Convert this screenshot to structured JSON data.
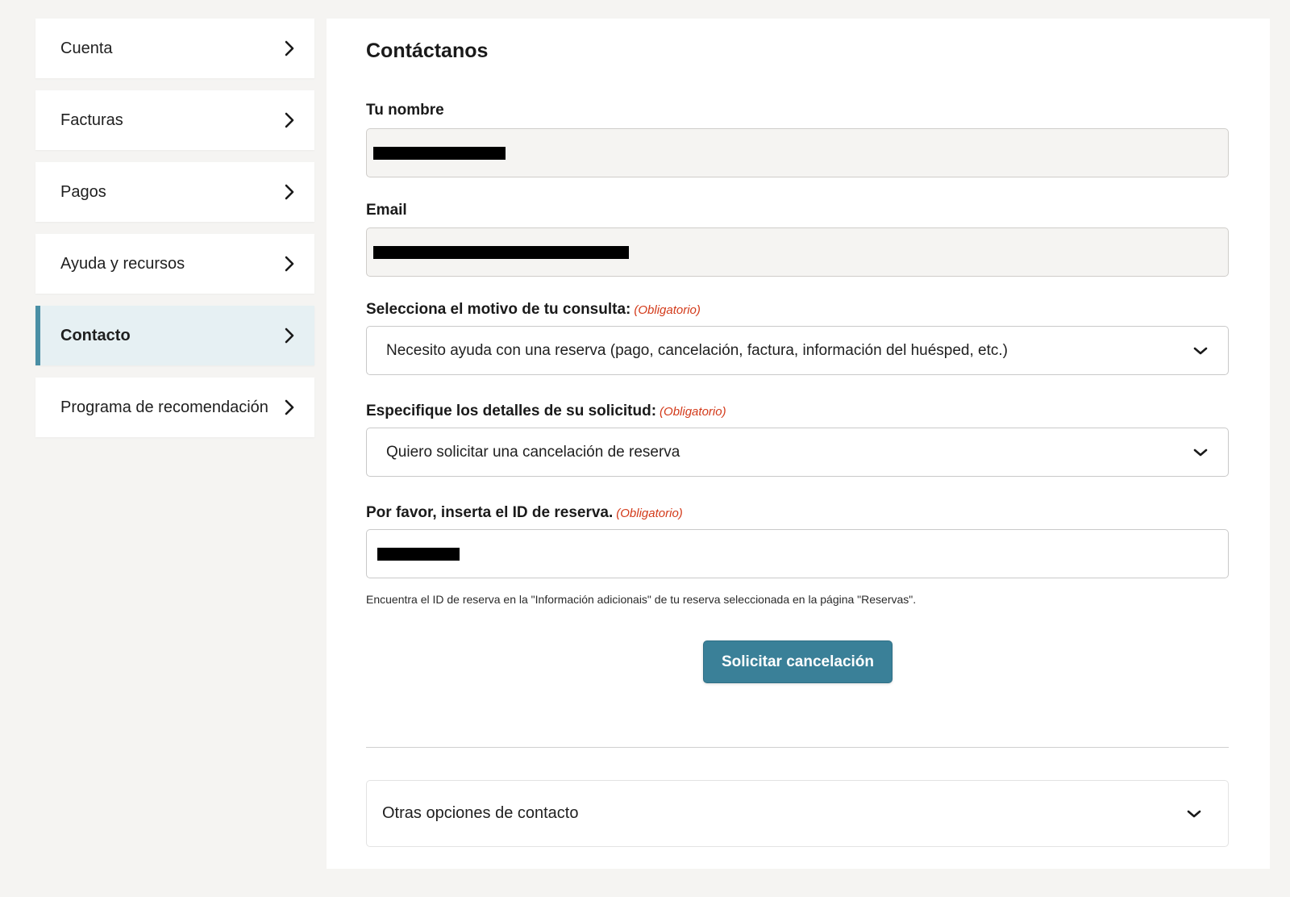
{
  "sidebar": {
    "items": [
      {
        "label": "Cuenta"
      },
      {
        "label": "Facturas"
      },
      {
        "label": "Pagos"
      },
      {
        "label": "Ayuda y recursos"
      },
      {
        "label": "Contacto",
        "active": true
      },
      {
        "label": "Programa de recomendación"
      }
    ]
  },
  "form": {
    "title": "Contáctanos",
    "name_label": "Tu nombre",
    "email_label": "Email",
    "reason_label": "Selecciona el motivo de tu consulta:",
    "reason_value": "Necesito ayuda con una reserva (pago, cancelación, factura, información del huésped, etc.)",
    "details_label": "Especifique los detalles de su solicitud:",
    "details_value": "Quiero solicitar una cancelación de reserva",
    "booking_label": "Por favor, inserta el ID de reserva.",
    "required_text": "(Obligatorio)",
    "helper_text": "Encuentra el ID de reserva en la \"Información adicionais\" de tu reserva seleccionada en la página \"Reservas\".",
    "submit_label": "Solicitar cancelación",
    "other_options_label": "Otras opciones de contacto"
  },
  "colors": {
    "accent": "#3a8098",
    "required": "#d33a1a",
    "active_bg": "#e6f0f3"
  }
}
